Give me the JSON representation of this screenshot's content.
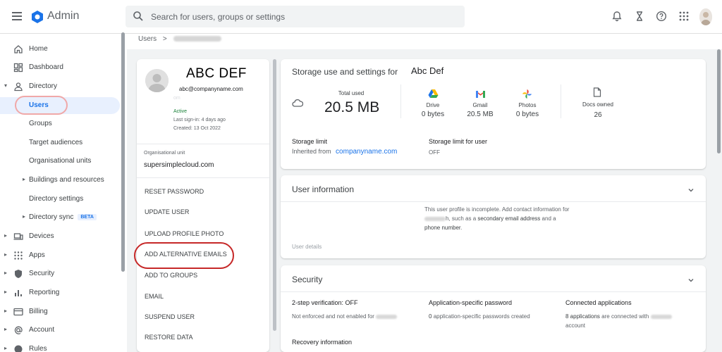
{
  "app": {
    "title": "Admin"
  },
  "search": {
    "placeholder": "Search for users, groups or settings"
  },
  "sidebar": {
    "items": [
      {
        "label": "Home",
        "icon": "home-icon"
      },
      {
        "label": "Dashboard",
        "icon": "dashboard-icon"
      },
      {
        "label": "Directory",
        "icon": "person-icon"
      },
      {
        "label": "Users"
      },
      {
        "label": "Groups"
      },
      {
        "label": "Target audiences"
      },
      {
        "label": "Organisational units"
      },
      {
        "label": "Buildings and resources"
      },
      {
        "label": "Directory settings"
      },
      {
        "label": "Directory sync",
        "badge": "BETA"
      },
      {
        "label": "Devices",
        "icon": "devices-icon"
      },
      {
        "label": "Apps",
        "icon": "apps-grid-icon"
      },
      {
        "label": "Security",
        "icon": "shield-icon"
      },
      {
        "label": "Reporting",
        "icon": "bar-chart-icon"
      },
      {
        "label": "Billing",
        "icon": "credit-card-icon"
      },
      {
        "label": "Account",
        "icon": "at-sign-icon"
      },
      {
        "label": "Rules",
        "icon": "rules-icon"
      }
    ]
  },
  "breadcrumb": {
    "root": "Users",
    "separator": ">"
  },
  "profile": {
    "name": "ABC DEF",
    "email": "abc@companyname.com",
    "faint": "om",
    "status": "Active",
    "last_signin": "Last sign-in: 4 days ago",
    "created": "Created: 13 Oct 2022",
    "org_unit_label": "Organisational unit",
    "org_unit_value": "supersimplecloud.com"
  },
  "actions": [
    "RESET PASSWORD",
    "UPDATE USER",
    "UPLOAD PROFILE PHOTO",
    "ADD ALTERNATIVE EMAILS",
    "ADD TO GROUPS",
    "EMAIL",
    "SUSPEND USER",
    "RESTORE DATA"
  ],
  "storage": {
    "title": "Storage use and settings for",
    "user_name": "Abc Def",
    "total_label": "Total used",
    "total_value": "20.5 MB",
    "services": [
      {
        "name": "Drive",
        "value": "0 bytes",
        "icon": "drive-icon"
      },
      {
        "name": "Gmail",
        "value": "20.5 MB",
        "icon": "gmail-icon"
      },
      {
        "name": "Photos",
        "value": "0 bytes",
        "icon": "photos-icon"
      }
    ],
    "docs_label": "Docs owned",
    "docs_value": "26",
    "limit_label": "Storage limit",
    "limit_inherited": "Inherited from",
    "limit_link": "companyname.com",
    "limit_user_label": "Storage limit for user",
    "limit_user_value": "OFF"
  },
  "user_info": {
    "title": "User information",
    "message_1": "This user profile is incomplete. Add contact information for",
    "message_2": "h, such as a",
    "message_3": "secondary email address",
    "message_4": "and a",
    "message_5": "phone number",
    "message_6": ".",
    "details_link": "User details"
  },
  "security": {
    "title": "Security",
    "two_step_title": "2-step verification: OFF",
    "two_step_text": "Not enforced and not enabled for",
    "app_pw_title": "Application-specific password",
    "app_pw_count": "0",
    "app_pw_text": "application-specific passwords created",
    "connected_title": "Connected applications",
    "connected_count": "8 applications",
    "connected_text": "are connected with",
    "connected_text_2": "account",
    "recovery_title": "Recovery information"
  },
  "colors": {
    "accent": "#1a73e8",
    "active_status": "#188038",
    "annotation_red": "#c62828"
  }
}
